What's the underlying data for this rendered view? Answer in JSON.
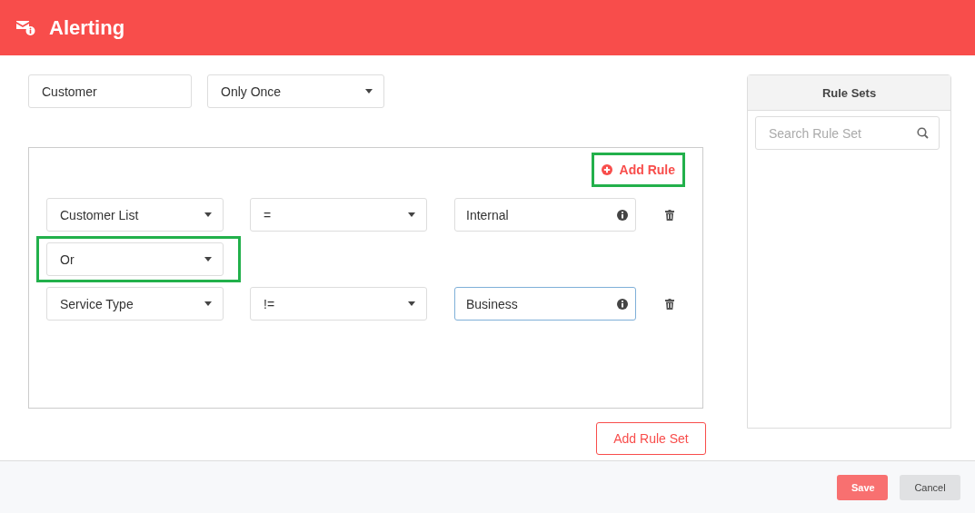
{
  "header": {
    "title": "Alerting"
  },
  "alert_name": {
    "value": "Customer"
  },
  "frequency": {
    "value": "Only Once"
  },
  "rule_group": {
    "add_rule": {
      "label": "Add Rule",
      "highlighted": true
    },
    "items": [
      {
        "kind": "rule",
        "field": "Customer List",
        "operator": "=",
        "value": "Internal",
        "focused": false
      },
      {
        "kind": "combinator",
        "value": "Or",
        "highlighted": true
      },
      {
        "kind": "rule",
        "field": "Service Type",
        "operator": "!=",
        "value": "Business",
        "focused": true
      }
    ]
  },
  "add_rule_set": {
    "label": "Add Rule Set"
  },
  "rule_sets": {
    "title": "Rule Sets",
    "search": {
      "placeholder": "Search Rule Set"
    }
  },
  "footer": {
    "buttons": [
      {
        "label": "Save",
        "kind": "primary"
      },
      {
        "label": "Cancel",
        "kind": "secondary"
      }
    ]
  }
}
